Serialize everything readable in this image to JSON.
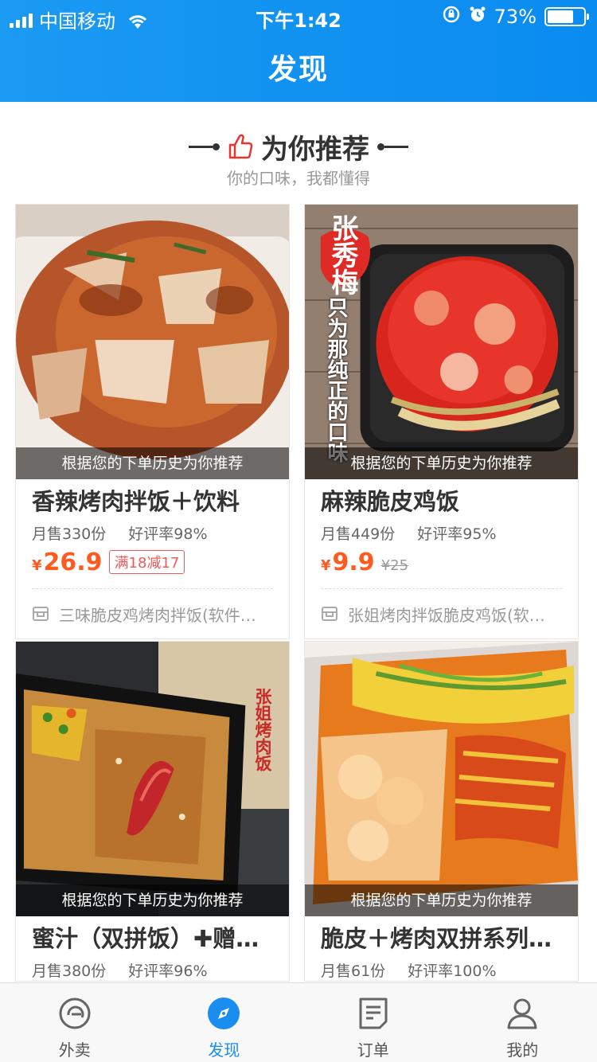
{
  "status_bar": {
    "carrier": "中国移动",
    "time": "下午1:42",
    "battery": "73%",
    "battery_level": 0.73
  },
  "header": {
    "title": "发现"
  },
  "recommend": {
    "title": "为你推荐",
    "subtitle": "你的口味，我都懂得"
  },
  "cards": [
    {
      "name": "香辣烤肉拌饭＋饮料",
      "overlay": "根据您的下单历史为你推荐",
      "sales": "月售330份",
      "rating": "好评率98%",
      "yen": "¥",
      "price": "26.9",
      "tag": "满18减17",
      "old_price": "",
      "shop": "三味脆皮鸡烤肉拌饭(软件…"
    },
    {
      "name": "麻辣脆皮鸡饭",
      "overlay": "根据您的下单历史为你推荐",
      "sales": "月售449份",
      "rating": "好评率95%",
      "yen": "¥",
      "price": "9.9",
      "tag": "",
      "old_price": "¥25",
      "shop": "张姐烤肉拌饭脆皮鸡饭(软…",
      "sign_text": "张秀梅",
      "side_text": "只为那纯正的口味"
    },
    {
      "name": "蜜汁（双拼饭）✚赠…",
      "overlay": "根据您的下单历史为你推荐",
      "sales": "月售380份",
      "rating": "好评率96%",
      "sign_text": "张姐烤肉饭"
    },
    {
      "name": "脆皮＋烤肉双拼系列…",
      "overlay": "根据您的下单历史为你推荐",
      "sales": "月售61份",
      "rating": "好评率100%"
    }
  ],
  "tabs": [
    {
      "label": "外卖",
      "icon": "takeout-icon"
    },
    {
      "label": "发现",
      "icon": "compass-icon"
    },
    {
      "label": "订单",
      "icon": "order-icon"
    },
    {
      "label": "我的",
      "icon": "profile-icon"
    }
  ],
  "colors": {
    "header": "#1a9af2",
    "accent": "#ff5a1f",
    "tab_active": "#1a8df0"
  }
}
